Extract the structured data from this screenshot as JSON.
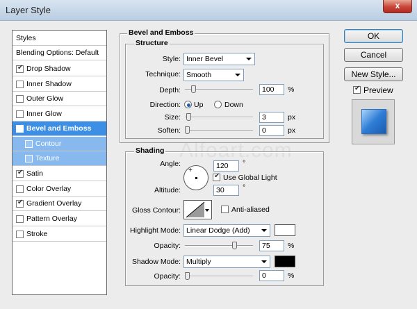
{
  "window": {
    "title": "Layer Style",
    "close_glyph": "x"
  },
  "styles_panel": {
    "items": [
      {
        "label": "Styles",
        "checkbox": false,
        "checked": false,
        "state": "header"
      },
      {
        "label": "Blending Options: Default",
        "checkbox": false,
        "checked": false,
        "state": "header"
      },
      {
        "label": "Drop Shadow",
        "checkbox": true,
        "checked": true,
        "state": "normal"
      },
      {
        "label": "Inner Shadow",
        "checkbox": true,
        "checked": false,
        "state": "normal"
      },
      {
        "label": "Outer Glow",
        "checkbox": true,
        "checked": false,
        "state": "normal"
      },
      {
        "label": "Inner Glow",
        "checkbox": true,
        "checked": false,
        "state": "normal"
      },
      {
        "label": "Bevel and Emboss",
        "checkbox": true,
        "checked": true,
        "state": "selected"
      },
      {
        "label": "Contour",
        "checkbox": true,
        "checked": false,
        "state": "sub"
      },
      {
        "label": "Texture",
        "checkbox": true,
        "checked": false,
        "state": "sub"
      },
      {
        "label": "Satin",
        "checkbox": true,
        "checked": true,
        "state": "normal"
      },
      {
        "label": "Color Overlay",
        "checkbox": true,
        "checked": false,
        "state": "normal"
      },
      {
        "label": "Gradient Overlay",
        "checkbox": true,
        "checked": true,
        "state": "normal"
      },
      {
        "label": "Pattern Overlay",
        "checkbox": true,
        "checked": false,
        "state": "normal"
      },
      {
        "label": "Stroke",
        "checkbox": true,
        "checked": false,
        "state": "normal"
      }
    ]
  },
  "bevel": {
    "group_title": "Bevel and Emboss",
    "structure_title": "Structure",
    "style_label": "Style:",
    "style_value": "Inner Bevel",
    "technique_label": "Technique:",
    "technique_value": "Smooth",
    "depth_label": "Depth:",
    "depth_value": "100",
    "depth_unit": "%",
    "depth_slider_fraction": 0.1,
    "direction_label": "Direction:",
    "direction_up": "Up",
    "direction_down": "Down",
    "size_label": "Size:",
    "size_value": "3",
    "size_unit": "px",
    "size_slider_fraction": 0.02,
    "soften_label": "Soften:",
    "soften_value": "0",
    "soften_unit": "px",
    "soften_slider_fraction": 0.0
  },
  "shading": {
    "title": "Shading",
    "angle_label": "Angle:",
    "angle_value": "120",
    "angle_unit": "°",
    "global_light_label": "Use Global Light",
    "global_light_checked": true,
    "altitude_label": "Altitude:",
    "altitude_value": "30",
    "altitude_unit": "°",
    "gloss_label": "Gloss Contour:",
    "anti_aliased_label": "Anti-aliased",
    "anti_aliased_checked": false,
    "highlight_mode_label": "Highlight Mode:",
    "highlight_mode_value": "Linear Dodge (Add)",
    "highlight_color": "#ffffff",
    "highlight_opacity_label": "Opacity:",
    "highlight_opacity_value": "75",
    "highlight_opacity_unit": "%",
    "highlight_opacity_fraction": 0.75,
    "shadow_mode_label": "Shadow Mode:",
    "shadow_mode_value": "Multiply",
    "shadow_color": "#000000",
    "shadow_opacity_label": "Opacity:",
    "shadow_opacity_value": "0",
    "shadow_opacity_unit": "%",
    "shadow_opacity_fraction": 0.0
  },
  "buttons": {
    "ok": "OK",
    "cancel": "Cancel",
    "new_style": "New Style...",
    "preview_label": "Preview",
    "preview_checked": true
  },
  "watermark": "Alfoart.com",
  "colors": {
    "selected": "#3d8fe6",
    "sub_selected": "#87b9ef",
    "accent": "#1b5fb3"
  }
}
